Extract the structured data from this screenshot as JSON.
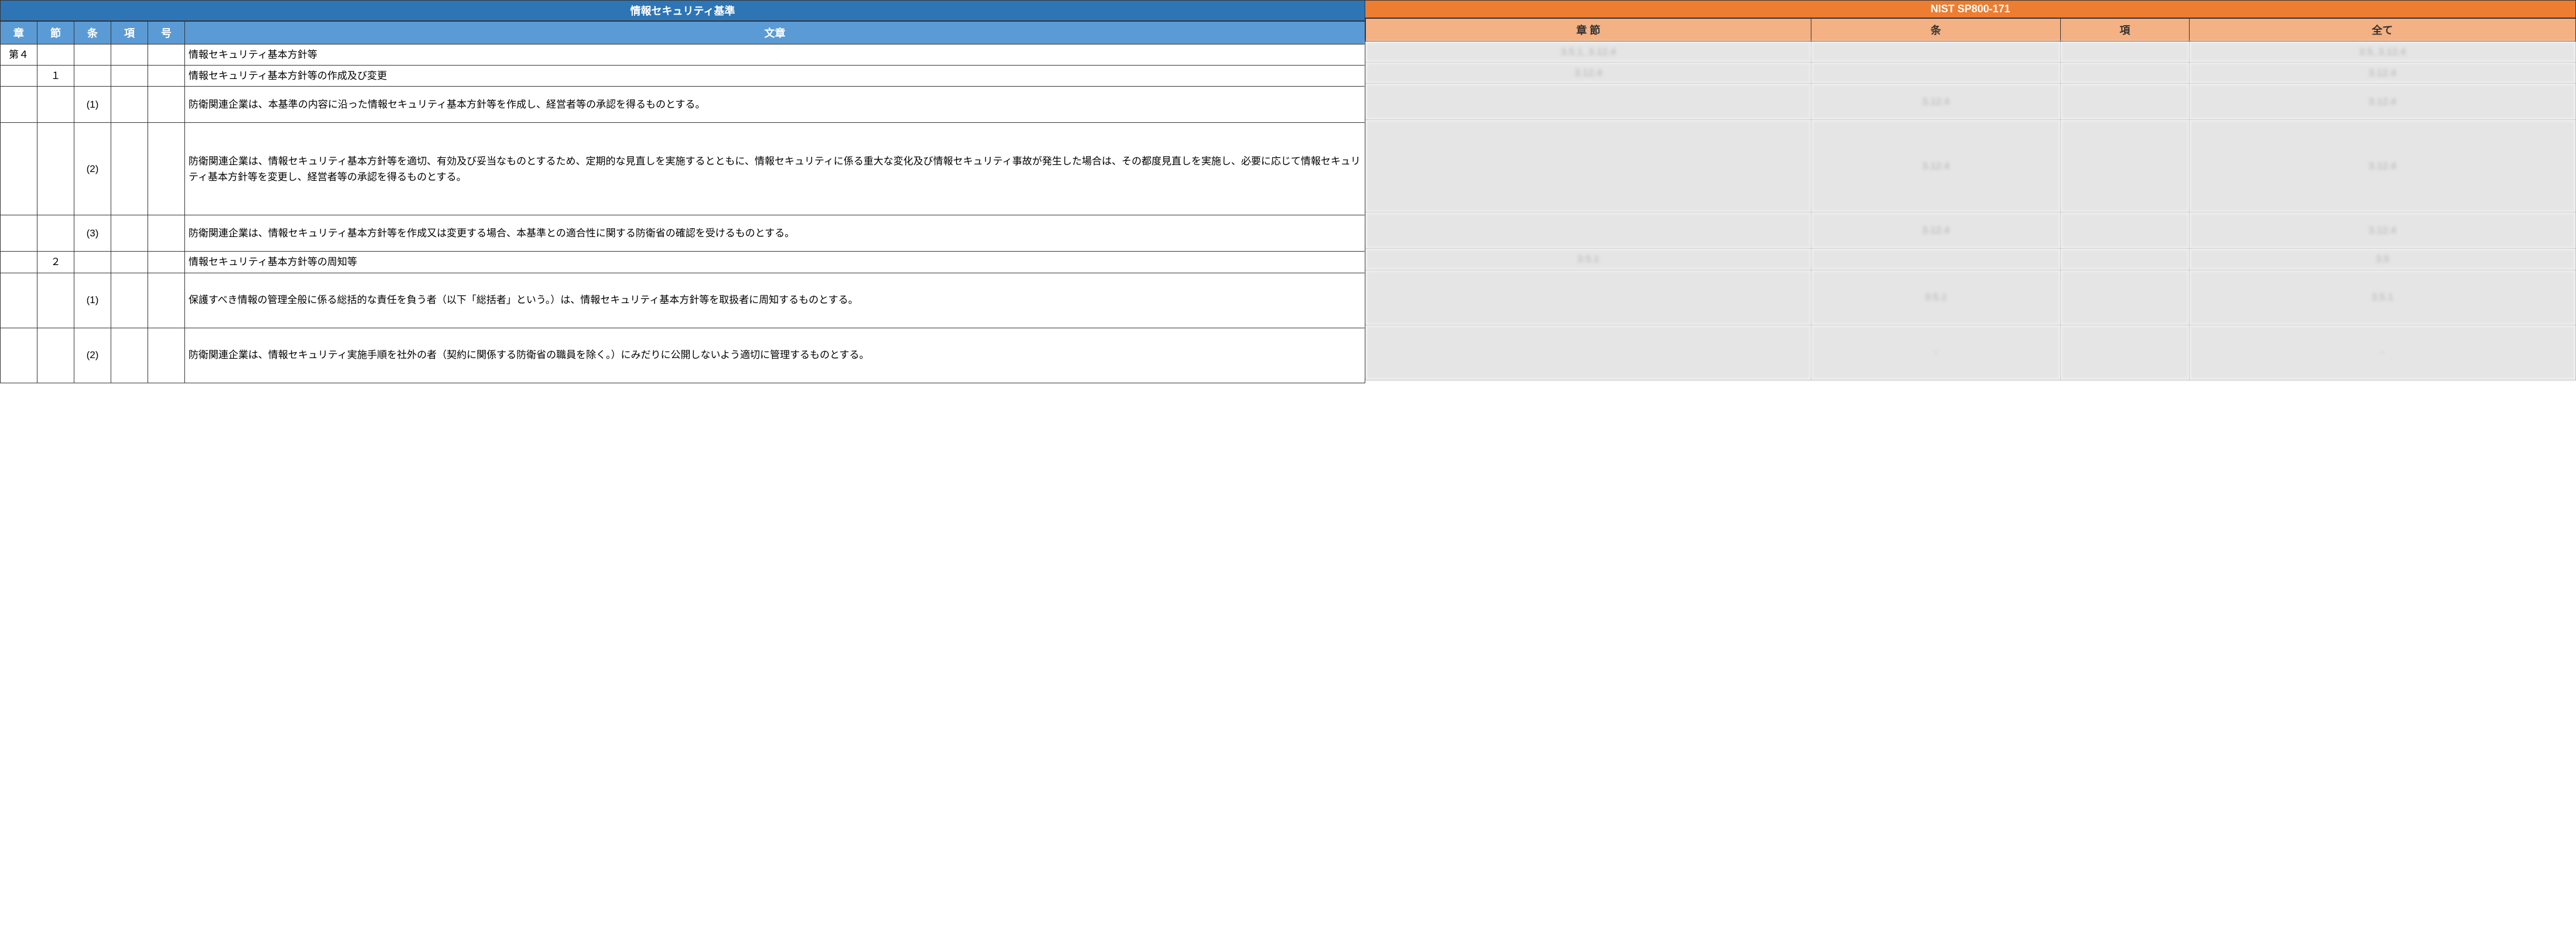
{
  "left": {
    "mainTitle": "情報セキュリティ基準",
    "headers": {
      "c1": "章",
      "c2": "節",
      "c3": "条",
      "c4": "項",
      "c5": "号",
      "c6": "文章"
    },
    "rows": [
      {
        "c1": "第４",
        "c2": "",
        "c3": "",
        "c4": "",
        "c5": "",
        "c6": "情報セキュリティ基本方針等"
      },
      {
        "c1": "",
        "c2": "１",
        "c3": "",
        "c4": "",
        "c5": "",
        "c6": "情報セキュリティ基本方針等の作成及び変更"
      },
      {
        "c1": "",
        "c2": "",
        "c3": "(1)",
        "c4": "",
        "c5": "",
        "c6": "防衛関連企業は、本基準の内容に沿った情報セキュリティ基本方針等を作成し、経営者等の承認を得るものとする。"
      },
      {
        "c1": "",
        "c2": "",
        "c3": "(2)",
        "c4": "",
        "c5": "",
        "c6": "防衛関連企業は、情報セキュリティ基本方針等を適切、有効及び妥当なものとするため、定期的な見直しを実施するとともに、情報セキュリティに係る重大な変化及び情報セキュリティ事故が発生した場合は、その都度見直しを実施し、必要に応じて情報セキュリティ基本方針等を変更し、経営者等の承認を得るものとする。"
      },
      {
        "c1": "",
        "c2": "",
        "c3": "(3)",
        "c4": "",
        "c5": "",
        "c6": "防衛関連企業は、情報セキュリティ基本方針等を作成又は変更する場合、本基準との適合性に関する防衛省の確認を受けるものとする。"
      },
      {
        "c1": "",
        "c2": "２",
        "c3": "",
        "c4": "",
        "c5": "",
        "c6": "情報セキュリティ基本方針等の周知等"
      },
      {
        "c1": "",
        "c2": "",
        "c3": "(1)",
        "c4": "",
        "c5": "",
        "c6": "保護すべき情報の管理全般に係る総括的な責任を負う者（以下「総括者」という。）は、情報セキュリティ基本方針等を取扱者に周知するものとする。"
      },
      {
        "c1": "",
        "c2": "",
        "c3": "(2)",
        "c4": "",
        "c5": "",
        "c6": "防衛関連企業は、情報セキュリティ実施手順を社外の者（契約に関係する防衛省の職員を除く。）にみだりに公開しないよう適切に管理するものとする。"
      }
    ]
  },
  "right": {
    "mainTitle": "NIST SP800-171",
    "headers": {
      "c1": "章 節",
      "c2": "条",
      "c3": "項",
      "c4": "全て"
    },
    "rows": [
      {
        "c1": "3.5.1, 3.12.4",
        "c2": "",
        "c3": "",
        "c4": "3.5, 3.12.4"
      },
      {
        "c1": "3.12.4",
        "c2": "",
        "c3": "",
        "c4": "3.12.4"
      },
      {
        "c1": "",
        "c2": "3.12.4",
        "c3": "",
        "c4": "3.12.4"
      },
      {
        "c1": "",
        "c2": "3.12.4",
        "c3": "",
        "c4": "3.12.4"
      },
      {
        "c1": "",
        "c2": "3.12.4",
        "c3": "",
        "c4": "3.12.4"
      },
      {
        "c1": "3.5.1",
        "c2": "",
        "c3": "",
        "c4": "3.5"
      },
      {
        "c1": "",
        "c2": "3.5.1",
        "c3": "",
        "c4": "3.5.1"
      },
      {
        "c1": "",
        "c2": "-",
        "c3": "",
        "c4": "-"
      }
    ]
  }
}
